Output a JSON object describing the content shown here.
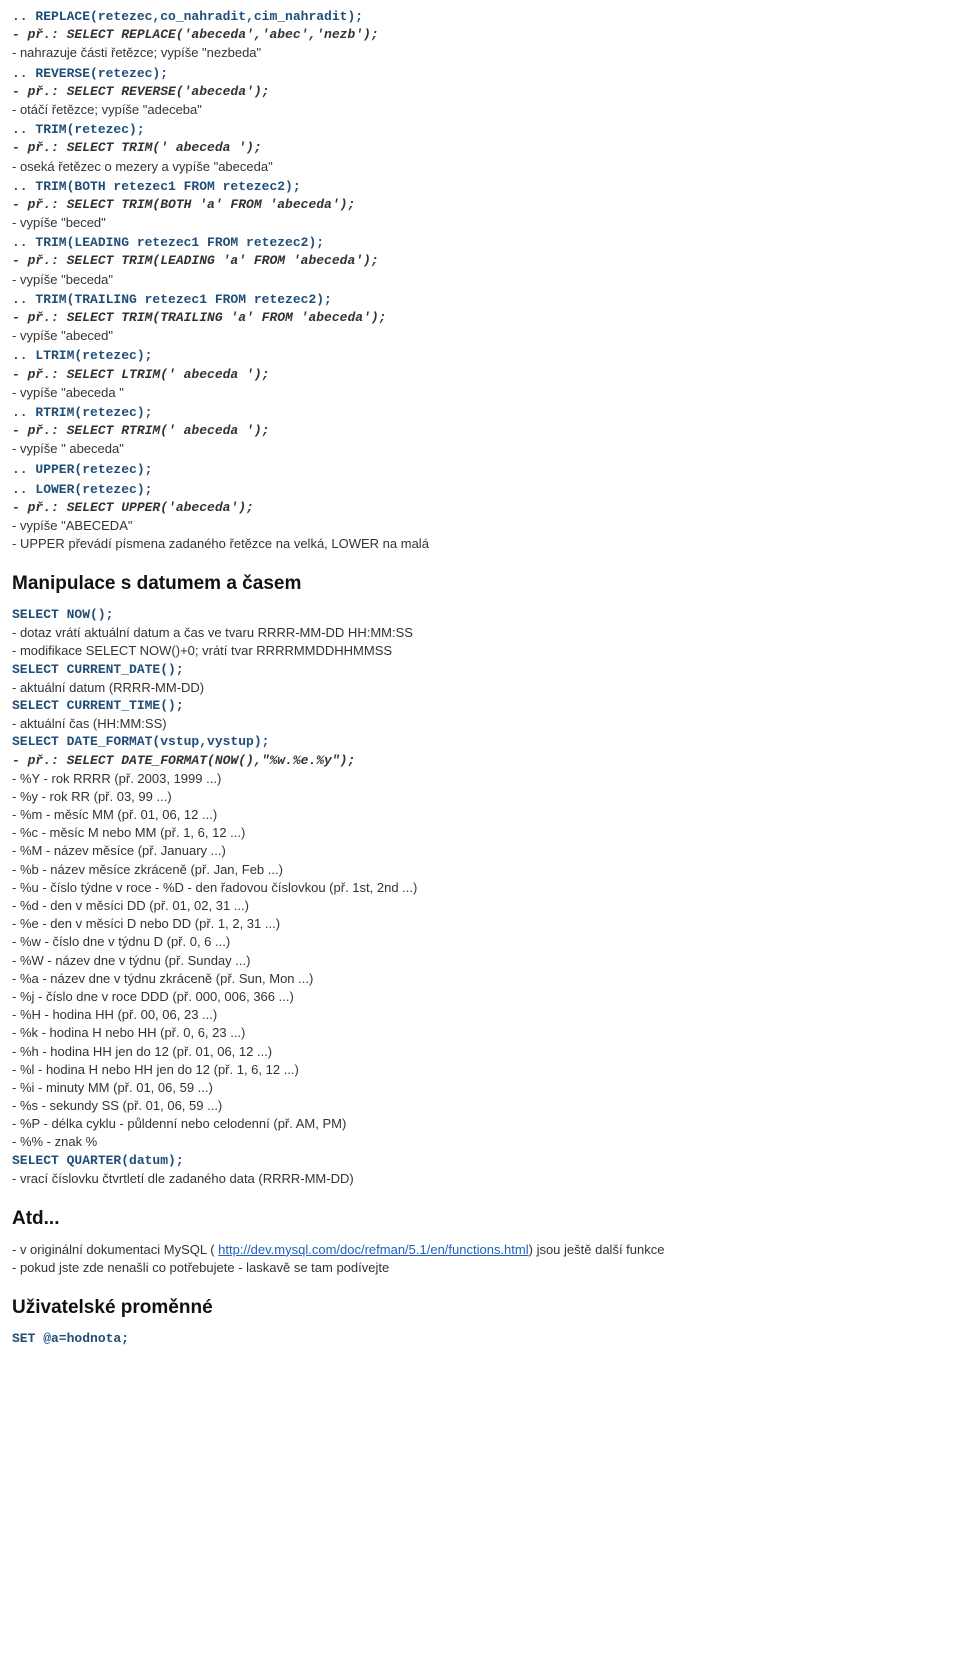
{
  "blocks": [
    {
      "head": ".. REPLACE(retezec,co_nahradit,cim_nahradit);",
      "ex": "- př.: SELECT REPLACE('abeceda','abec','nezb');",
      "d": [
        "- nahrazuje části řetězce; vypíše \"nezbeda\""
      ]
    },
    {
      "head": ".. REVERSE(retezec);",
      "ex": "- př.: SELECT REVERSE('abeceda');",
      "d": [
        "- otáčí řetězce; vypíše \"adeceba\""
      ]
    },
    {
      "head": ".. TRIM(retezec);",
      "ex": "- př.: SELECT TRIM('  abeceda  ');",
      "d": [
        "- oseká řetězec o mezery a vypíše \"abeceda\""
      ]
    },
    {
      "head": ".. TRIM(BOTH retezec1 FROM retezec2);",
      "ex": "- př.: SELECT TRIM(BOTH 'a' FROM 'abeceda');",
      "d": [
        "- vypíše \"beced\""
      ]
    },
    {
      "head": ".. TRIM(LEADING retezec1 FROM retezec2);",
      "ex": "- př.: SELECT TRIM(LEADING 'a' FROM 'abeceda');",
      "d": [
        "- vypíše \"beceda\""
      ]
    },
    {
      "head": ".. TRIM(TRAILING retezec1 FROM retezec2);",
      "ex": "- př.: SELECT TRIM(TRAILING 'a' FROM 'abeceda');",
      "d": [
        "- vypíše \"abeced\""
      ]
    },
    {
      "head": ".. LTRIM(retezec);",
      "ex": "- př.: SELECT LTRIM('  abeceda  ');",
      "d": [
        "- vypíše \"abeceda  \""
      ]
    },
    {
      "head": ".. RTRIM(retezec);",
      "ex": "- př.: SELECT RTRIM('  abeceda  ');",
      "d": [
        "- vypíše \"  abeceda\""
      ]
    },
    {
      "head": ".. UPPER(retezec);",
      "ex": "",
      "d": []
    },
    {
      "head": ".. LOWER(retezec);",
      "ex": "- př.: SELECT UPPER('abeceda');",
      "d": [
        "- vypíše \"ABECEDA\"",
        "- UPPER převádí písmena zadaného řetězce na velká, LOWER na malá"
      ]
    }
  ],
  "h1": "Manipulace s datumem a časem",
  "dt": {
    "now_head": "SELECT NOW();",
    "now_d": [
      "- dotaz vrátí aktuální datum a čas ve tvaru RRRR-MM-DD HH:MM:SS",
      "- modifikace SELECT NOW()+0; vrátí tvar RRRRMMDDHHMMSS"
    ],
    "curdate_head": "SELECT CURRENT_DATE();",
    "curdate_d": [
      "- aktuální datum (RRRR-MM-DD)"
    ],
    "curtime_head": "SELECT CURRENT_TIME();",
    "curtime_d": [
      "- aktuální čas (HH:MM:SS)"
    ],
    "fmt_head": "SELECT DATE_FORMAT(vstup,vystup);",
    "fmt_ex": "- př.: SELECT DATE_FORMAT(NOW(),\"%w.%e.%y\");",
    "fmt_d": [
      "- %Y - rok RRRR (př. 2003, 1999 ...)",
      "- %y - rok RR (př. 03, 99 ...)",
      "- %m - měsíc MM (př. 01, 06, 12 ...)",
      "- %c - měsíc M nebo MM (př. 1, 6, 12 ...)",
      "- %M - název měsíce (př. January ...)",
      "- %b - název měsíce zkráceně (př. Jan, Feb ...)",
      "- %u - číslo týdne v roce - %D - den řadovou číslovkou (př. 1st, 2nd ...)",
      "- %d - den v měsíci DD (př. 01, 02, 31 ...)",
      "- %e - den v měsíci D nebo DD (př. 1, 2, 31 ...)",
      "- %w - číslo dne v týdnu D (př. 0, 6 ...)",
      "- %W - název dne v týdnu (př. Sunday ...)",
      "- %a - název dne v týdnu zkráceně (př. Sun, Mon ...)",
      "- %j - číslo dne v roce DDD (př. 000, 006, 366 ...)",
      "- %H - hodina HH (př. 00, 06, 23 ...)",
      "- %k - hodina H nebo HH (př. 0, 6, 23 ...)",
      "- %h - hodina HH jen do 12 (př. 01, 06, 12 ...)",
      "- %l - hodina H nebo HH jen do 12 (př. 1, 6, 12 ...)",
      "- %i - minuty MM (př. 01, 06, 59 ...)",
      "- %s - sekundy SS (př. 01, 06, 59 ...)",
      "- %P - délka cyklu - půldenní nebo celodenní (př. AM, PM)",
      "- %% - znak %"
    ],
    "quarter_head": "SELECT QUARTER(datum);",
    "quarter_d": [
      "- vrací číslovku čtvrtletí dle zadaného data (RRRR-MM-DD)"
    ]
  },
  "h2": "Atd...",
  "atd": {
    "pre": "- v originální dokumentaci MySQL ( ",
    "link": "http://dev.mysql.com/doc/refman/5.1/en/functions.html",
    "post": ") jsou ještě další funkce",
    "line2": "- pokud jste zde nenašli co potřebujete - laskavě se tam podívejte"
  },
  "h3": "Uživatelské proměnné",
  "uvar_head": "SET @a=hodnota;"
}
